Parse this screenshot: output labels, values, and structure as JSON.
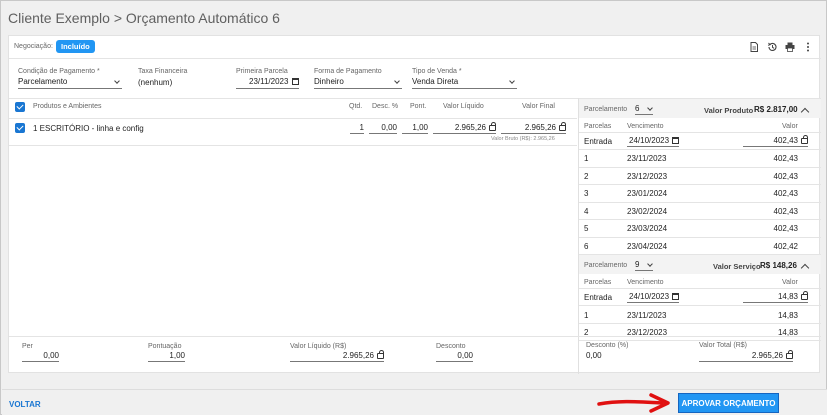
{
  "page": {
    "title": "Cliente Exemplo > Orçamento Automático 6"
  },
  "header": {
    "negociacao_label": "Negociação:",
    "negociacao_status": "Incluído"
  },
  "fields": {
    "condicao": {
      "label": "Condição de Pagamento *",
      "value": "Parcelamento"
    },
    "taxa": {
      "label": "Taxa Financeira",
      "value": "(nenhum)"
    },
    "primeira": {
      "label": "Primeira Parcela",
      "value": "23/11/2023"
    },
    "forma": {
      "label": "Forma de Pagamento",
      "value": "Dinheiro"
    },
    "tipo": {
      "label": "Tipo de Venda *",
      "value": "Venda Direta"
    }
  },
  "products": {
    "headers": {
      "produtos": "Produtos e Ambientes",
      "qtd": "Qtd.",
      "desc": "Desc. %",
      "pont": "Pont.",
      "liquido": "Valor Líquido",
      "final": "Valor Final"
    },
    "rows": [
      {
        "name": "1 ESCRITÓRIO - linha e config",
        "qtd": "1",
        "desc": "0,00",
        "pont": "1,00",
        "liquido": "2.965,26",
        "final": "2.965,26",
        "bruto": "Valor Bruto (R$): 2.965,26"
      }
    ]
  },
  "produto_panel": {
    "parcelamento_label": "Parcelamento",
    "parcelamento_value": "6",
    "valor_label": "Valor Produto",
    "valor": "R$ 2.817,00",
    "headers": {
      "parcelas": "Parcelas",
      "vencimento": "Vencimento",
      "valor": "Valor"
    },
    "entrada": {
      "label": "Entrada",
      "date": "24/10/2023",
      "value": "402,43"
    },
    "rows": [
      {
        "n": "1",
        "date": "23/11/2023",
        "value": "402,43"
      },
      {
        "n": "2",
        "date": "23/12/2023",
        "value": "402,43"
      },
      {
        "n": "3",
        "date": "23/01/2024",
        "value": "402,43"
      },
      {
        "n": "4",
        "date": "23/02/2024",
        "value": "402,43"
      },
      {
        "n": "5",
        "date": "23/03/2024",
        "value": "402,43"
      },
      {
        "n": "6",
        "date": "23/04/2024",
        "value": "402,42"
      }
    ]
  },
  "servico_panel": {
    "parcelamento_label": "Parcelamento",
    "parcelamento_value": "9",
    "valor_label": "Valor Serviço",
    "valor": "R$ 148,26",
    "headers": {
      "parcelas": "Parcelas",
      "vencimento": "Vencimento",
      "valor": "Valor"
    },
    "entrada": {
      "label": "Entrada",
      "date": "24/10/2023",
      "value": "14,83"
    },
    "rows": [
      {
        "n": "1",
        "date": "23/11/2023",
        "value": "14,83"
      },
      {
        "n": "2",
        "date": "23/12/2023",
        "value": "14,83"
      }
    ]
  },
  "totals": {
    "per": {
      "label": "Per",
      "value": "0,00"
    },
    "pontuacao": {
      "label": "Pontuação",
      "value": "1,00"
    },
    "liquido": {
      "label": "Valor Líquido (R$)",
      "value": "2.965,26"
    },
    "desconto": {
      "label": "Desconto",
      "value": "0,00"
    },
    "desconto_pct": {
      "label": "Desconto (%)",
      "value": "0,00"
    },
    "total": {
      "label": "Valor Total (R$)",
      "value": "2.965,26"
    }
  },
  "footer": {
    "voltar": "VOLTAR",
    "aprovar": "APROVAR ORÇAMENTO"
  },
  "colors": {
    "accent": "#2196f3",
    "arrow": "#e01010"
  }
}
